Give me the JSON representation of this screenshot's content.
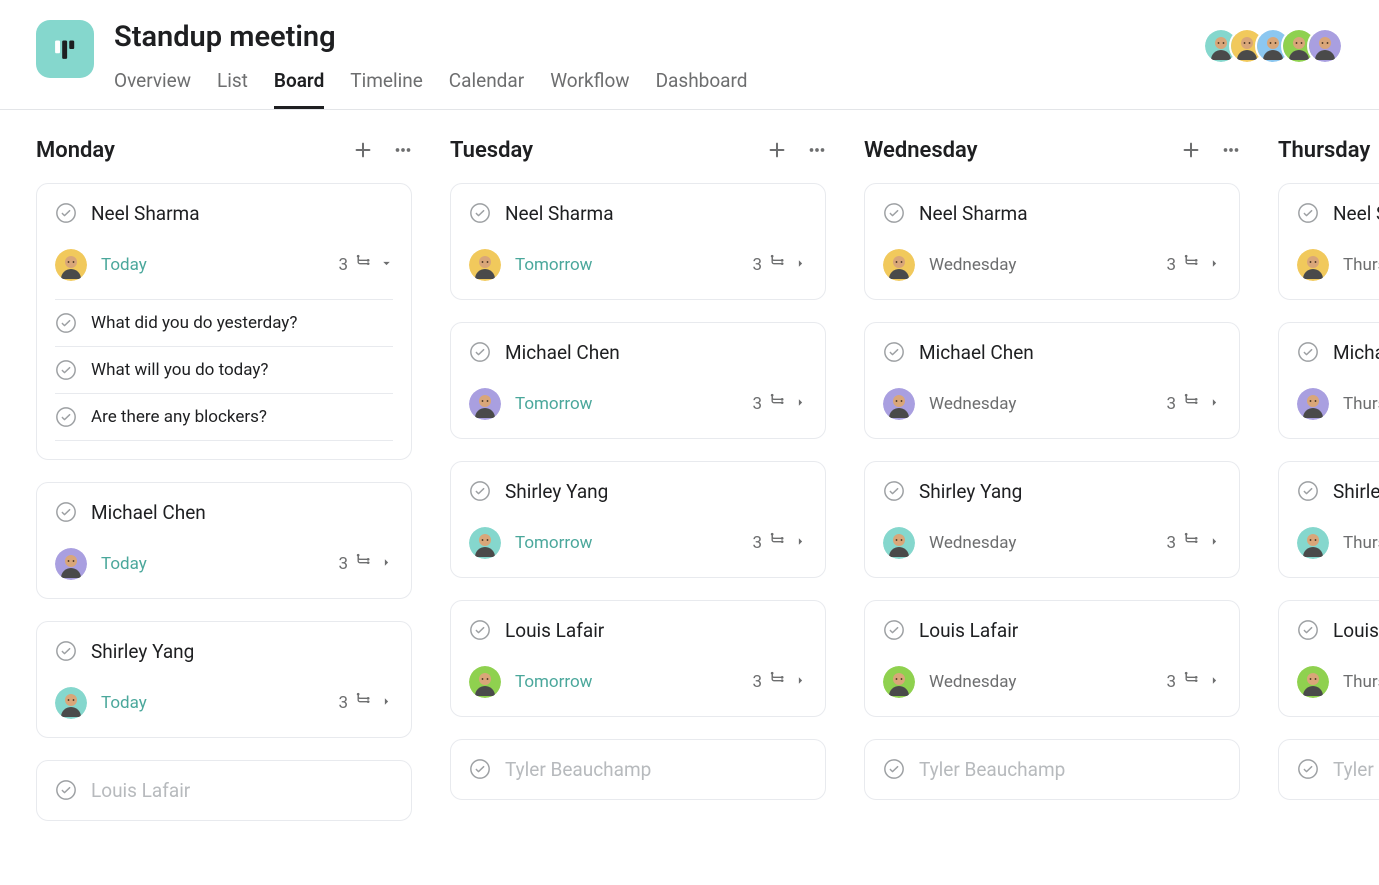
{
  "project": {
    "title": "Standup meeting"
  },
  "tabs": [
    {
      "label": "Overview",
      "active": false
    },
    {
      "label": "List",
      "active": false
    },
    {
      "label": "Board",
      "active": true
    },
    {
      "label": "Timeline",
      "active": false
    },
    {
      "label": "Calendar",
      "active": false
    },
    {
      "label": "Workflow",
      "active": false
    },
    {
      "label": "Dashboard",
      "active": false
    }
  ],
  "members": [
    {
      "name": "Shirley Yang",
      "color": "#85d7cd"
    },
    {
      "name": "Neel Sharma",
      "color": "#f1c95c"
    },
    {
      "name": "Tyler Beauchamp",
      "color": "#8cc7f0"
    },
    {
      "name": "Louis Lafair",
      "color": "#8fd14f"
    },
    {
      "name": "Michael Chen",
      "color": "#a99fe0"
    }
  ],
  "people": {
    "neel": {
      "name": "Neel Sharma",
      "color": "#f1c95c"
    },
    "michael": {
      "name": "Michael Chen",
      "color": "#a99fe0"
    },
    "shirley": {
      "name": "Shirley Yang",
      "color": "#85d7cd"
    },
    "louis": {
      "name": "Louis Lafair",
      "color": "#8fd14f"
    },
    "tyler": {
      "name": "Tyler Beauchamp",
      "color": "#8cc7f0"
    }
  },
  "subtask_questions": [
    "What did you do yesterday?",
    "What will you do today?",
    "Are there any blockers?"
  ],
  "columns": [
    {
      "title": "Monday",
      "cards": [
        {
          "person": "neel",
          "date": "Today",
          "dateStyle": "teal",
          "subs": 3,
          "expanded": true,
          "showMeta": true
        },
        {
          "person": "michael",
          "date": "Today",
          "dateStyle": "teal",
          "subs": 3,
          "showMeta": true
        },
        {
          "person": "shirley",
          "date": "Today",
          "dateStyle": "teal",
          "subs": 3,
          "showMeta": true
        },
        {
          "person": "louis",
          "fade": true,
          "showMeta": false
        }
      ]
    },
    {
      "title": "Tuesday",
      "cards": [
        {
          "person": "neel",
          "date": "Tomorrow",
          "dateStyle": "teal",
          "subs": 3,
          "showMeta": true
        },
        {
          "person": "michael",
          "date": "Tomorrow",
          "dateStyle": "teal",
          "subs": 3,
          "showMeta": true
        },
        {
          "person": "shirley",
          "date": "Tomorrow",
          "dateStyle": "teal",
          "subs": 3,
          "showMeta": true
        },
        {
          "person": "louis",
          "date": "Tomorrow",
          "dateStyle": "teal",
          "subs": 3,
          "showMeta": true
        },
        {
          "person": "tyler",
          "fade": true,
          "showMeta": false
        }
      ]
    },
    {
      "title": "Wednesday",
      "cards": [
        {
          "person": "neel",
          "date": "Wednesday",
          "dateStyle": "muted",
          "subs": 3,
          "showMeta": true
        },
        {
          "person": "michael",
          "date": "Wednesday",
          "dateStyle": "muted",
          "subs": 3,
          "showMeta": true
        },
        {
          "person": "shirley",
          "date": "Wednesday",
          "dateStyle": "muted",
          "subs": 3,
          "showMeta": true
        },
        {
          "person": "louis",
          "date": "Wednesday",
          "dateStyle": "muted",
          "subs": 3,
          "showMeta": true
        },
        {
          "person": "tyler",
          "fade": true,
          "showMeta": false
        }
      ]
    },
    {
      "title": "Thursday",
      "cards": [
        {
          "person": "neel",
          "date": "Thursday",
          "dateStyle": "muted",
          "subs": 3,
          "showMeta": true,
          "short": "Neel S"
        },
        {
          "person": "michael",
          "date": "Thursday",
          "dateStyle": "muted",
          "subs": 3,
          "showMeta": true,
          "short": "Micha"
        },
        {
          "person": "shirley",
          "date": "Thursday",
          "dateStyle": "muted",
          "subs": 3,
          "showMeta": true,
          "short": "Shirle"
        },
        {
          "person": "louis",
          "date": "Thursday",
          "dateStyle": "muted",
          "subs": 3,
          "showMeta": true,
          "short": "Louis"
        },
        {
          "person": "tyler",
          "fade": true,
          "showMeta": false,
          "short": "Tyler"
        }
      ]
    }
  ]
}
